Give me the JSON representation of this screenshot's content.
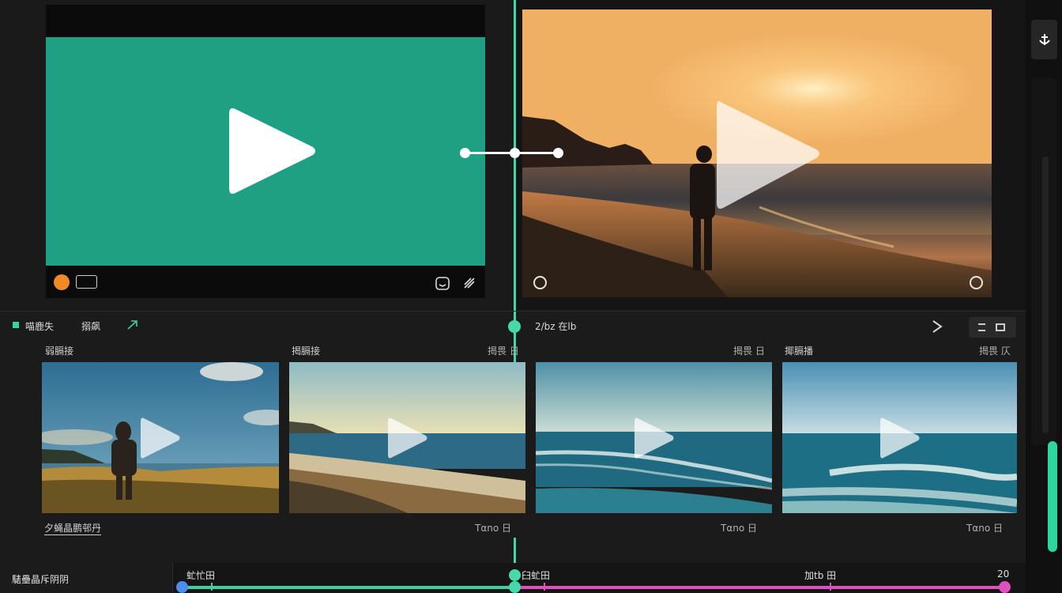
{
  "toolbar": {
    "item1": "喵鹿失",
    "item2": "搦飙",
    "timecode": "2/bz 在lb",
    "nav_next": "›"
  },
  "clips": [
    {
      "title": "弱膈接",
      "meta": "",
      "footer": "夕蝇晶鹏邨丹"
    },
    {
      "title": "揭膈接",
      "meta": "揭畏 日",
      "footer": "Tαno 日"
    },
    {
      "title": "",
      "meta": "揭畏 日",
      "footer": "Tαno 日"
    },
    {
      "title": "揶膈播",
      "meta": "揭畏 仄",
      "footer": "Tαno 日"
    }
  ],
  "timeline": {
    "left_label": "騞壘晶斥阴阴",
    "marker1": "虻忙田",
    "marker2": "臼虻田",
    "marker3": "加tb 田",
    "end_value": "20"
  },
  "colors": {
    "accent_green": "#2ed6a0",
    "accent_pink": "#e04fc0",
    "record_orange": "#f08a24",
    "left_canvas": "#1fa083"
  },
  "icons": [
    "play-icon",
    "record-icon",
    "caption-icon",
    "undo-icon",
    "redo-icon",
    "circle-icon",
    "minus-circle-icon",
    "anchor-icon",
    "share-icon",
    "chevron-right-icon",
    "expand-icon"
  ]
}
